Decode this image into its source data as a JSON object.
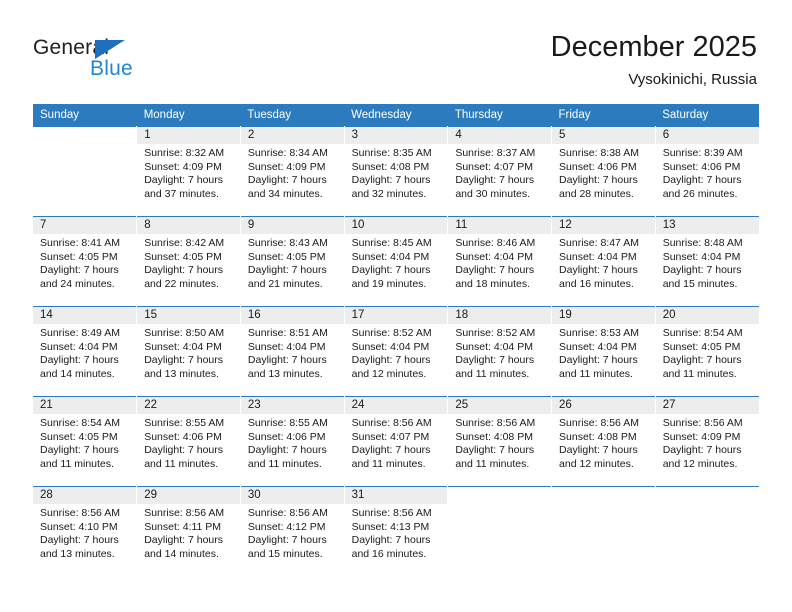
{
  "brand": {
    "name_top": "General",
    "name_bottom": "Blue",
    "triangle_icon": "brand-triangle-icon",
    "color_dark": "#231f20",
    "color_blue": "#1f86d8"
  },
  "header": {
    "title": "December 2025",
    "subtitle": "Vysokinichi, Russia"
  },
  "theme": {
    "header_blue": "#2c7bbf",
    "daynum_band": "#ededed",
    "text": "#1a1a1a"
  },
  "weekdays": [
    "Sunday",
    "Monday",
    "Tuesday",
    "Wednesday",
    "Thursday",
    "Friday",
    "Saturday"
  ],
  "weeks": [
    [
      {
        "day": "",
        "lines": []
      },
      {
        "day": "1",
        "lines": [
          "Sunrise: 8:32 AM",
          "Sunset: 4:09 PM",
          "Daylight: 7 hours",
          "and 37 minutes."
        ]
      },
      {
        "day": "2",
        "lines": [
          "Sunrise: 8:34 AM",
          "Sunset: 4:09 PM",
          "Daylight: 7 hours",
          "and 34 minutes."
        ]
      },
      {
        "day": "3",
        "lines": [
          "Sunrise: 8:35 AM",
          "Sunset: 4:08 PM",
          "Daylight: 7 hours",
          "and 32 minutes."
        ]
      },
      {
        "day": "4",
        "lines": [
          "Sunrise: 8:37 AM",
          "Sunset: 4:07 PM",
          "Daylight: 7 hours",
          "and 30 minutes."
        ]
      },
      {
        "day": "5",
        "lines": [
          "Sunrise: 8:38 AM",
          "Sunset: 4:06 PM",
          "Daylight: 7 hours",
          "and 28 minutes."
        ]
      },
      {
        "day": "6",
        "lines": [
          "Sunrise: 8:39 AM",
          "Sunset: 4:06 PM",
          "Daylight: 7 hours",
          "and 26 minutes."
        ]
      }
    ],
    [
      {
        "day": "7",
        "lines": [
          "Sunrise: 8:41 AM",
          "Sunset: 4:05 PM",
          "Daylight: 7 hours",
          "and 24 minutes."
        ]
      },
      {
        "day": "8",
        "lines": [
          "Sunrise: 8:42 AM",
          "Sunset: 4:05 PM",
          "Daylight: 7 hours",
          "and 22 minutes."
        ]
      },
      {
        "day": "9",
        "lines": [
          "Sunrise: 8:43 AM",
          "Sunset: 4:05 PM",
          "Daylight: 7 hours",
          "and 21 minutes."
        ]
      },
      {
        "day": "10",
        "lines": [
          "Sunrise: 8:45 AM",
          "Sunset: 4:04 PM",
          "Daylight: 7 hours",
          "and 19 minutes."
        ]
      },
      {
        "day": "11",
        "lines": [
          "Sunrise: 8:46 AM",
          "Sunset: 4:04 PM",
          "Daylight: 7 hours",
          "and 18 minutes."
        ]
      },
      {
        "day": "12",
        "lines": [
          "Sunrise: 8:47 AM",
          "Sunset: 4:04 PM",
          "Daylight: 7 hours",
          "and 16 minutes."
        ]
      },
      {
        "day": "13",
        "lines": [
          "Sunrise: 8:48 AM",
          "Sunset: 4:04 PM",
          "Daylight: 7 hours",
          "and 15 minutes."
        ]
      }
    ],
    [
      {
        "day": "14",
        "lines": [
          "Sunrise: 8:49 AM",
          "Sunset: 4:04 PM",
          "Daylight: 7 hours",
          "and 14 minutes."
        ]
      },
      {
        "day": "15",
        "lines": [
          "Sunrise: 8:50 AM",
          "Sunset: 4:04 PM",
          "Daylight: 7 hours",
          "and 13 minutes."
        ]
      },
      {
        "day": "16",
        "lines": [
          "Sunrise: 8:51 AM",
          "Sunset: 4:04 PM",
          "Daylight: 7 hours",
          "and 13 minutes."
        ]
      },
      {
        "day": "17",
        "lines": [
          "Sunrise: 8:52 AM",
          "Sunset: 4:04 PM",
          "Daylight: 7 hours",
          "and 12 minutes."
        ]
      },
      {
        "day": "18",
        "lines": [
          "Sunrise: 8:52 AM",
          "Sunset: 4:04 PM",
          "Daylight: 7 hours",
          "and 11 minutes."
        ]
      },
      {
        "day": "19",
        "lines": [
          "Sunrise: 8:53 AM",
          "Sunset: 4:04 PM",
          "Daylight: 7 hours",
          "and 11 minutes."
        ]
      },
      {
        "day": "20",
        "lines": [
          "Sunrise: 8:54 AM",
          "Sunset: 4:05 PM",
          "Daylight: 7 hours",
          "and 11 minutes."
        ]
      }
    ],
    [
      {
        "day": "21",
        "lines": [
          "Sunrise: 8:54 AM",
          "Sunset: 4:05 PM",
          "Daylight: 7 hours",
          "and 11 minutes."
        ]
      },
      {
        "day": "22",
        "lines": [
          "Sunrise: 8:55 AM",
          "Sunset: 4:06 PM",
          "Daylight: 7 hours",
          "and 11 minutes."
        ]
      },
      {
        "day": "23",
        "lines": [
          "Sunrise: 8:55 AM",
          "Sunset: 4:06 PM",
          "Daylight: 7 hours",
          "and 11 minutes."
        ]
      },
      {
        "day": "24",
        "lines": [
          "Sunrise: 8:56 AM",
          "Sunset: 4:07 PM",
          "Daylight: 7 hours",
          "and 11 minutes."
        ]
      },
      {
        "day": "25",
        "lines": [
          "Sunrise: 8:56 AM",
          "Sunset: 4:08 PM",
          "Daylight: 7 hours",
          "and 11 minutes."
        ]
      },
      {
        "day": "26",
        "lines": [
          "Sunrise: 8:56 AM",
          "Sunset: 4:08 PM",
          "Daylight: 7 hours",
          "and 12 minutes."
        ]
      },
      {
        "day": "27",
        "lines": [
          "Sunrise: 8:56 AM",
          "Sunset: 4:09 PM",
          "Daylight: 7 hours",
          "and 12 minutes."
        ]
      }
    ],
    [
      {
        "day": "28",
        "lines": [
          "Sunrise: 8:56 AM",
          "Sunset: 4:10 PM",
          "Daylight: 7 hours",
          "and 13 minutes."
        ]
      },
      {
        "day": "29",
        "lines": [
          "Sunrise: 8:56 AM",
          "Sunset: 4:11 PM",
          "Daylight: 7 hours",
          "and 14 minutes."
        ]
      },
      {
        "day": "30",
        "lines": [
          "Sunrise: 8:56 AM",
          "Sunset: 4:12 PM",
          "Daylight: 7 hours",
          "and 15 minutes."
        ]
      },
      {
        "day": "31",
        "lines": [
          "Sunrise: 8:56 AM",
          "Sunset: 4:13 PM",
          "Daylight: 7 hours",
          "and 16 minutes."
        ]
      },
      {
        "day": "",
        "lines": []
      },
      {
        "day": "",
        "lines": []
      },
      {
        "day": "",
        "lines": []
      }
    ]
  ]
}
